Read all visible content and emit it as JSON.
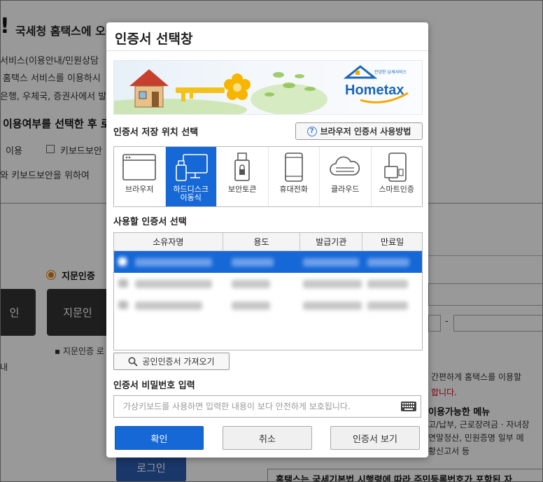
{
  "background": {
    "header_mark": "!",
    "header_title": "국세청 홈택스에 오신것을 환영합니다",
    "line1": "서비스(이용안내/민원상담",
    "line2": "홈택스 서비스를 이용하시",
    "line3": "은행, 우체국, 증권사에서 발",
    "question": "이용여부를 선택한 후 로",
    "option_use": "이용",
    "option_keyboard": "키보드보안",
    "line4": "와 키보드보안을 위하여",
    "fingerprint_radio": "지문인증",
    "left_btn": "인",
    "fingerprint_btn": "지문인",
    "fingerprint_note": "▪ 지문인증 로",
    "left_note": "내",
    "login_btn": "로그인",
    "right1": "간편하게 홈택스를 이용할",
    "right2": "합니다.",
    "right3": "이용가능한 메뉴",
    "right4": "고/납부, 근로장려금 · 자녀장",
    "right5": "연말정산, 민원증명 일부 메",
    "right6": "황신고서 등",
    "footer": "홈택스는 국세기본법 시행령에 따라 주민등록번호가 포함된 자"
  },
  "dialog": {
    "title": "인증서 선택창",
    "banner": {
      "logo_top": "안녕한 납세서비스",
      "logo_main": "Hometax"
    },
    "storage_section_label": "인증서 저장 위치 선택",
    "help_button": "브라우저 인증서 사용방법",
    "storage_items": [
      {
        "label": "브라우저"
      },
      {
        "label": "하드디스크\n이동식"
      },
      {
        "label": "보안토큰"
      },
      {
        "label": "휴대전화"
      },
      {
        "label": "클라우드"
      },
      {
        "label": "스마트인증"
      }
    ],
    "cert_section_label": "사용할 인증서 선택",
    "table_headers": [
      "소유자명",
      "용도",
      "발급기관",
      "만료일"
    ],
    "import_button": "공인인증서 가져오기",
    "password_section_label": "인증서 비밀번호 입력",
    "password_placeholder": "가상키보드를 사용하면 입력한 내용이 보다 안전하게 보호됩니다.",
    "buttons": {
      "confirm": "확인",
      "cancel": "취소",
      "view_cert": "인증서 보기"
    }
  },
  "colors": {
    "accent": "#1668d6",
    "highlight_red": "#d0021b"
  }
}
